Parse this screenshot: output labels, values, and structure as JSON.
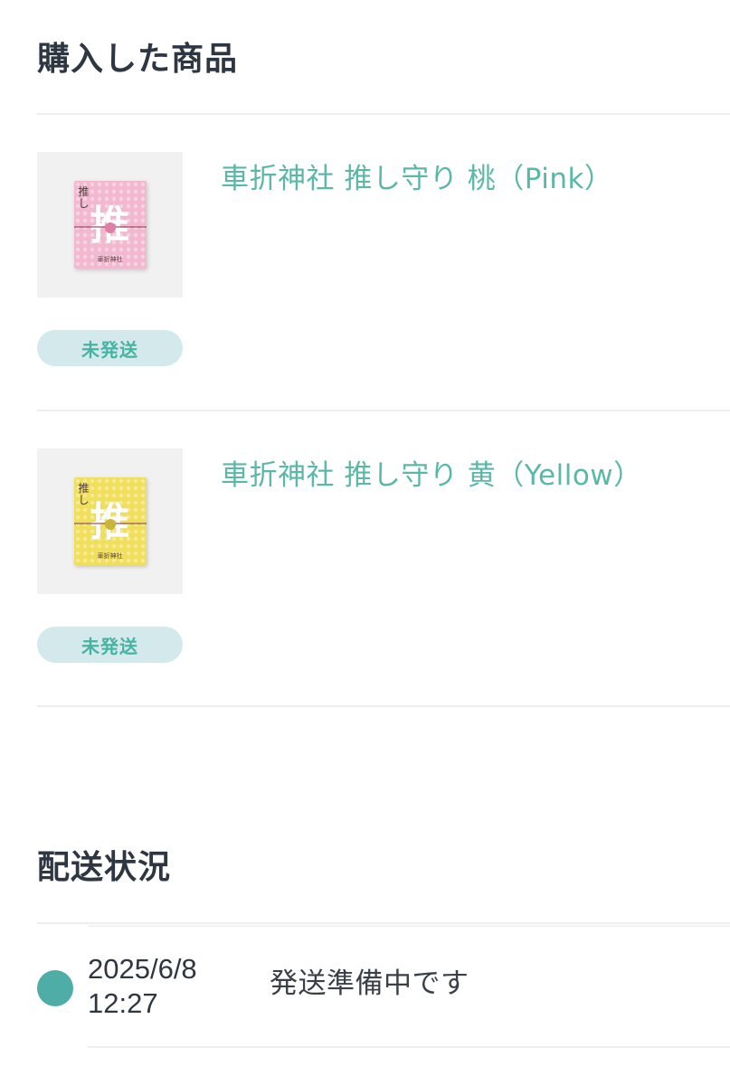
{
  "purchased": {
    "title": "購入した商品",
    "items": [
      {
        "name": "車折神社 推し守り 桃（Pink）",
        "status": "未発送",
        "image_color": "#f2b8cf",
        "image_pattern_color": "#f7d3e1",
        "image_text_small": "推し",
        "image_text_main": "推",
        "image_shrine_label": "車折神社"
      },
      {
        "name": "車折神社 推し守り 黄（Yellow）",
        "status": "未発送",
        "image_color": "#f0df5c",
        "image_pattern_color": "#f6ea95",
        "image_text_small": "推し",
        "image_text_main": "推",
        "image_shrine_label": "車折神社"
      }
    ]
  },
  "delivery": {
    "title": "配送状況",
    "events": [
      {
        "date": "2025/6/8",
        "time": "12:27",
        "message": "発送準備中です"
      }
    ]
  },
  "colors": {
    "accent": "#5ab8a8",
    "badge_bg": "#d3e9ec",
    "badge_text": "#49b3a3",
    "timeline_dot": "#4fada7",
    "heading": "#2e3642"
  }
}
